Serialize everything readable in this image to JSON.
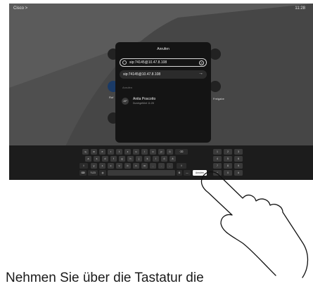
{
  "header": {
    "crumb": "Cisco >",
    "time": "11:28"
  },
  "background_labels": {
    "left": "Ruf",
    "right": "Freigabe"
  },
  "dialog": {
    "title": "Anrufen",
    "input_value": "sip:74145@10.47.8.108",
    "clear_icon": "close-icon",
    "suggestion": "sip:74145@10.47.8.108",
    "recents_label": "Anrufen",
    "contact": {
      "avatar": "AP",
      "name": "Anita Poscotto",
      "subtitle": "Durchgeführt 11:28"
    }
  },
  "keyboard": {
    "row1": [
      "q",
      "w",
      "e",
      "r",
      "t",
      "z",
      "u",
      "i",
      "o",
      "p",
      "ü"
    ],
    "row2": [
      "a",
      "s",
      "d",
      "f",
      "g",
      "h",
      "j",
      "k",
      "l",
      "ö",
      "ä"
    ],
    "row3": [
      "y",
      "x",
      "c",
      "v",
      "b",
      "n",
      "m",
      ",",
      ".",
      "-"
    ],
    "numpad": [
      "1",
      "2",
      "3",
      "4",
      "5",
      "6",
      "7",
      "8",
      "9",
      "*",
      "0",
      "#"
    ],
    "mode_label": "?123",
    "call_label": "Anrufen",
    "dash": "—"
  },
  "caption": "Nehmen Sie über die Tastatur die"
}
